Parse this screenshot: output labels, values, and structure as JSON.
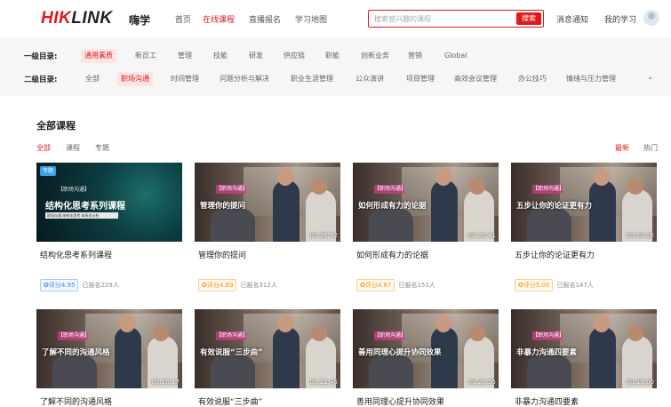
{
  "header": {
    "logo_red": "HIK",
    "logo_dark": "LINK",
    "site_name": "嗨学",
    "nav": [
      "首页",
      "在线课程",
      "直播报名",
      "学习地图"
    ],
    "active_nav": "在线课程",
    "search_placeholder": "搜索感兴趣的课程",
    "search_button": "搜索",
    "notify": "消息通知",
    "my_study": "我的学习",
    "accent": "#e0191a"
  },
  "filters": {
    "level1_label": "一级目录:",
    "level1": [
      "通用素质",
      "新员工",
      "管理",
      "技能",
      "研发",
      "供应链",
      "职能",
      "创新业务",
      "营销",
      "Global"
    ],
    "level1_selected": "通用素质",
    "level2_label": "二级目录:",
    "level2": [
      "全部",
      "职场沟通",
      "时间管理",
      "问题分析与解决",
      "职业生涯管理",
      "公众演讲",
      "项目管理",
      "高效会议管理",
      "办公技巧",
      "情绪与压力管理"
    ],
    "level2_selected": "职场沟通"
  },
  "section": {
    "title": "全部课程",
    "tabs": [
      "全部",
      "课程",
      "专题"
    ],
    "sort": [
      "最新",
      "热门"
    ]
  },
  "courses": [
    {
      "title": "结构化思考系列课程",
      "score": "评分4.95",
      "enrolled": "已报名229人",
      "thumb_title": "结构化思考系列课程",
      "tag": "【职场沟通】",
      "badge": "专题",
      "bar_text": "职场沟通 结构化思考 体系化分析",
      "score_color": "blue"
    },
    {
      "title": "管理你的提问",
      "score": "评分4.89",
      "enrolled": "已报名312人",
      "thumb_title": "管理你的提问",
      "tag": "【职场沟通】",
      "duration": "00:26:52",
      "score_color": "orange"
    },
    {
      "title": "如何形成有力的论据",
      "score": "评分4.87",
      "enrolled": "已报名151人",
      "thumb_title": "如何形成有力的论据",
      "tag": "【职场沟通】",
      "duration": "00:20:41",
      "score_color": "orange"
    },
    {
      "title": "五步让你的论证更有力",
      "score": "评分5.00",
      "enrolled": "已报名147人",
      "thumb_title": "五步让你的论证更有力",
      "tag": "【职场沟通】",
      "duration": "00:20:26",
      "score_color": "orange"
    },
    {
      "title": "了解不同的沟通风格",
      "thumb_title": "了解不同的沟通风格",
      "tag": "【职场沟通】",
      "duration": "00:26:17"
    },
    {
      "title": "有效说服“三步曲”",
      "thumb_title": "有效说服“三步曲”",
      "tag": "【职场沟通】",
      "duration": "00:22:46"
    },
    {
      "title": "善用同理心提升协同效果",
      "thumb_title": "善用同理心提升协同效果",
      "tag": "【职场沟通】",
      "duration": "00:20:55"
    },
    {
      "title": "非暴力沟通四要素",
      "thumb_title": "非暴力沟通四要素",
      "tag": "【职场沟通】",
      "duration": "00:19:00"
    }
  ]
}
